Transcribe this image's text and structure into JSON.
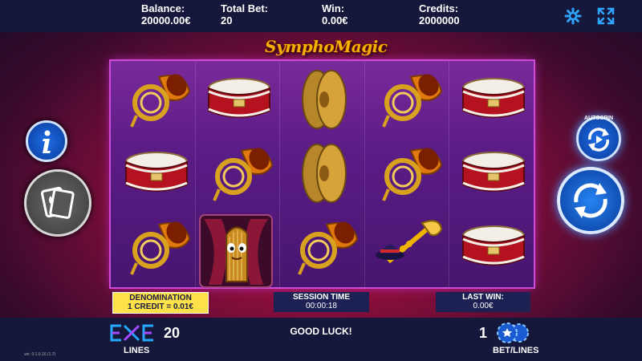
{
  "header": {
    "balance_label": "Balance:",
    "balance_value": "20000.00€",
    "total_bet_label": "Total Bet:",
    "total_bet_value": "20",
    "win_label": "Win:",
    "win_value": "0.00€",
    "credits_label": "Credits:",
    "credits_value": "2000000"
  },
  "game": {
    "logo_text": "SymphoMagic"
  },
  "reels": {
    "columns": [
      [
        "french-horn",
        "snare-drum",
        "french-horn"
      ],
      [
        "snare-drum",
        "french-horn",
        "harp-wild"
      ],
      [
        "cymbals",
        "cymbals",
        "french-horn"
      ],
      [
        "french-horn",
        "french-horn",
        "trumpet-hat"
      ],
      [
        "snare-drum",
        "snare-drum",
        "snare-drum"
      ]
    ]
  },
  "controls": {
    "autospin_label": "AUTOSPIN"
  },
  "panels": {
    "denomination_label": "DENOMINATION",
    "denomination_value": "1 CREDIT = 0.01€",
    "session_label": "SESSION TIME",
    "session_value": "00:00:18",
    "last_win_label": "LAST WIN:",
    "last_win_value": "0.00€"
  },
  "footer": {
    "lines_value": "20",
    "lines_label": "LINES",
    "message": "GOOD LUCK!",
    "bet_lines_value": "1",
    "bet_lines_label": "BET/LINES",
    "version": "ver. 0.1.0.16 (1.7)"
  },
  "colors": {
    "top_bar": "#15183a",
    "accent_blue": "#1e6ee6",
    "denomination_bg": "#ffe14a",
    "reel_bg": "#5b1c86"
  }
}
